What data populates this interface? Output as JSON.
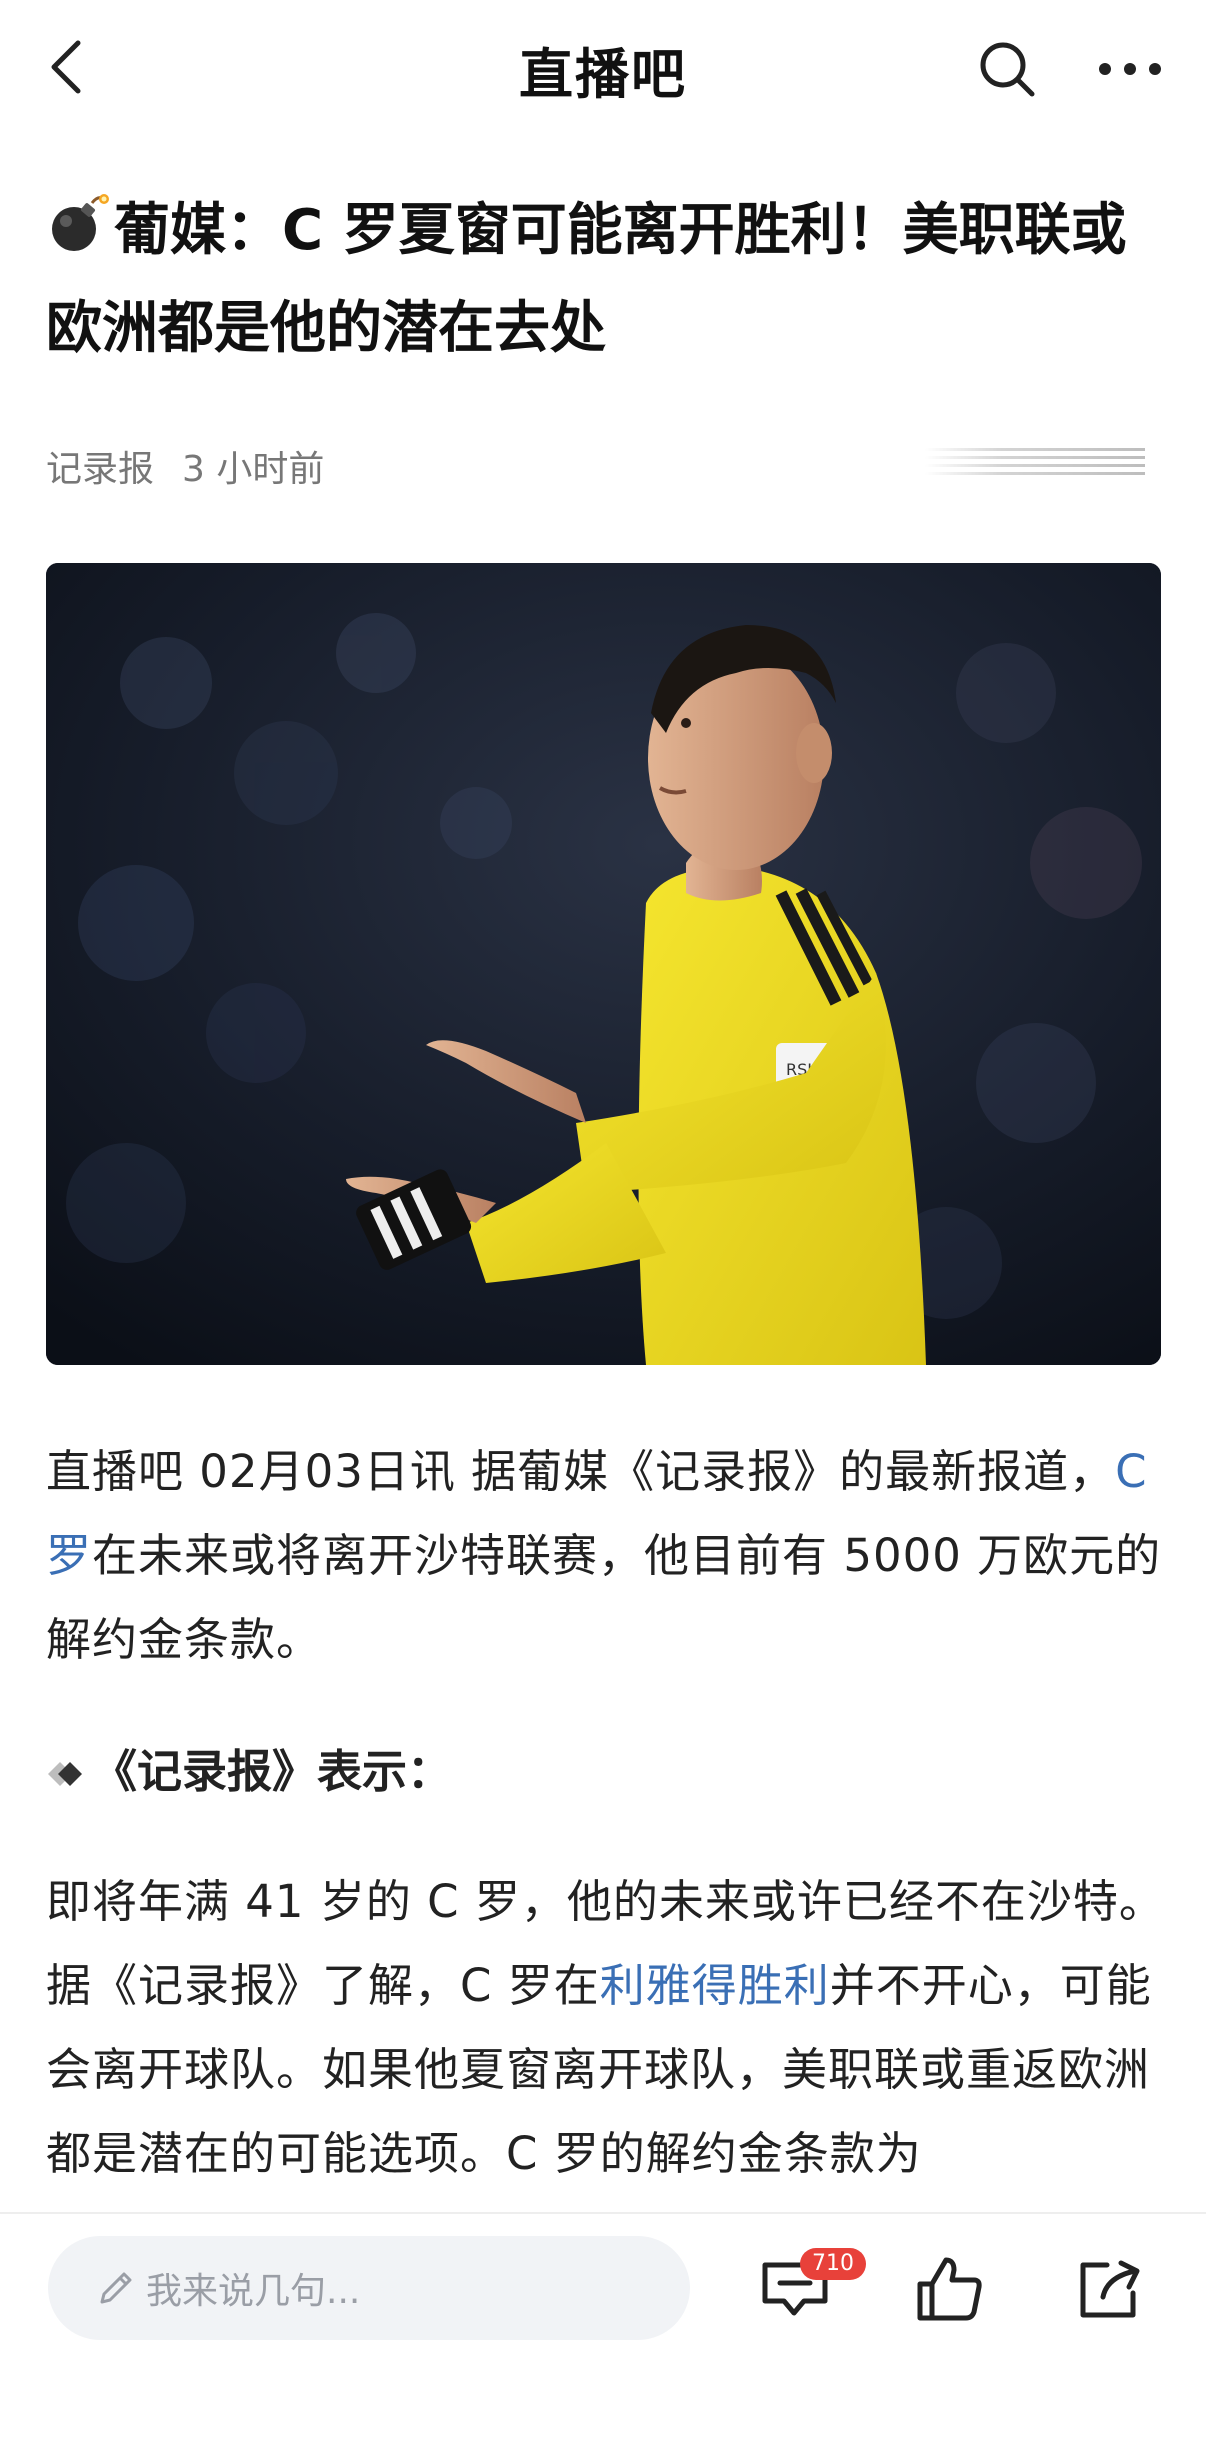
{
  "nav": {
    "title": "直播吧",
    "icons": {
      "back": "chevron-left-icon",
      "search": "search-icon",
      "more": "more-horizontal-icon"
    }
  },
  "article": {
    "emoji": "bomb-icon",
    "headline": "葡媒：C 罗夏窗可能离开胜利！美职联或欧洲都是他的潜在去处",
    "source": "记录报",
    "time": "3 小时前",
    "image_alt": "球员身穿黄色球衣手持队长袖标"
  },
  "body": {
    "p1_a": "直播吧 02月03日讯 据葡媒《记录报》的最新报道，",
    "p1_link": "C 罗",
    "p1_b": "在未来或将离开沙特联赛，他目前有 5000 万欧元的解约金条款。",
    "subheading": "《记录报》表示：",
    "p2_a": "即将年满 41 岁的 C 罗，他的未来或许已经不在沙特。据《记录报》了解，C 罗在",
    "p2_link": "利雅得胜利",
    "p2_b": "并不开心，可能会离开球队。如果他夏窗离开球队，美职联或重返欧洲都是潜在的可能选项。C 罗的解约金条款为"
  },
  "bottom_bar": {
    "comment_placeholder": "我来说几句...",
    "comment_count": "710",
    "icons": {
      "pen": "pencil-icon",
      "comment": "comment-icon",
      "like": "thumbs-up-icon",
      "share": "share-icon"
    }
  },
  "colors": {
    "link": "#3a6fb5",
    "badge": "#e8413a",
    "jersey": "#f2e028"
  }
}
